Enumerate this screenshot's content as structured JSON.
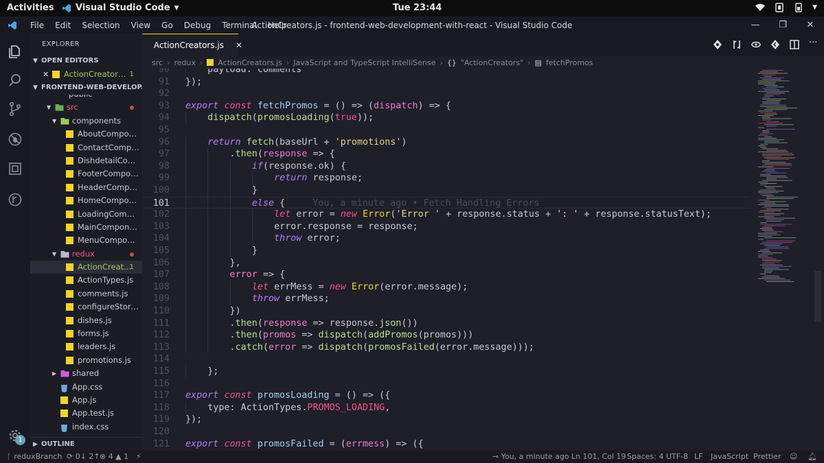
{
  "topbar": {
    "activities": "Activities",
    "app_name": "Visual Studio Code",
    "clock": "Tue 23:44"
  },
  "menubar": {
    "items": [
      "File",
      "Edit",
      "Selection",
      "View",
      "Go",
      "Debug",
      "Terminal",
      "Help"
    ],
    "window_title": "ActionCreators.js - frontend-web-development-with-react - Visual Studio Code"
  },
  "activity": {
    "badge": "1"
  },
  "sidebar": {
    "title": "EXPLORER",
    "open_editors": "OPEN EDITORS",
    "open_file": {
      "name": "ActionCreators...",
      "count": "1"
    },
    "project": "FRONTEND-WEB-DEVELOP...",
    "partial_top": "public",
    "rows": [
      {
        "name": "src",
        "type": "folder-open",
        "indent": 1,
        "color": "#f55385",
        "dot": true
      },
      {
        "name": "components",
        "type": "folder-open",
        "indent": 2
      },
      {
        "name": "AboutCompone...",
        "type": "js",
        "indent": 3
      },
      {
        "name": "ContactCompon...",
        "type": "js",
        "indent": 3
      },
      {
        "name": "DishdetailComp...",
        "type": "js",
        "indent": 3
      },
      {
        "name": "FooterCompone...",
        "type": "js",
        "indent": 3
      },
      {
        "name": "HeaderCompon...",
        "type": "js",
        "indent": 3
      },
      {
        "name": "HomeCompone...",
        "type": "js",
        "indent": 3
      },
      {
        "name": "LoadingCompon...",
        "type": "js",
        "indent": 3
      },
      {
        "name": "MainComponent.js",
        "type": "js",
        "indent": 3
      },
      {
        "name": "MenuComponen...",
        "type": "js",
        "indent": 3
      },
      {
        "name": "redux",
        "type": "folder-open",
        "indent": 2,
        "color": "#f55385",
        "dot": true
      },
      {
        "name": "ActionCreat...",
        "type": "js",
        "indent": 3,
        "color": "#9fca56",
        "count": "1",
        "selected": true
      },
      {
        "name": "ActionTypes.js",
        "type": "js",
        "indent": 3
      },
      {
        "name": "comments.js",
        "type": "js",
        "indent": 3
      },
      {
        "name": "configureStore.js",
        "type": "js",
        "indent": 3
      },
      {
        "name": "dishes.js",
        "type": "js",
        "indent": 3
      },
      {
        "name": "forms.js",
        "type": "js",
        "indent": 3
      },
      {
        "name": "leaders.js",
        "type": "js",
        "indent": 3
      },
      {
        "name": "promotions.js",
        "type": "js",
        "indent": 3
      },
      {
        "name": "shared",
        "type": "folder-closed",
        "indent": 2
      },
      {
        "name": "App.css",
        "type": "css",
        "indent": 2
      },
      {
        "name": "App.js",
        "type": "js",
        "indent": 2
      },
      {
        "name": "App.test.js",
        "type": "js",
        "indent": 2
      },
      {
        "name": "index.css",
        "type": "css",
        "indent": 2
      }
    ],
    "outline": "OUTLINE"
  },
  "editor": {
    "tab_label": "ActionCreators.js",
    "tab_close": "✕",
    "breadcrumb": [
      "src",
      "redux",
      "ActionCreators.js",
      "JavaScript and TypeScript IntelliSense",
      "\"ActionCreators\"",
      "fetchPromos"
    ],
    "current_line": 101,
    "blame": "You, a minute ago • Fetch Handling Errors",
    "lines": [
      {
        "n": 90,
        "indent": 1,
        "tokens": [
          [
            "plain",
            "payload: comments"
          ]
        ]
      },
      {
        "n": 91,
        "indent": 0,
        "tokens": [
          [
            "pun",
            "});"
          ]
        ]
      },
      {
        "n": 92,
        "indent": 0,
        "tokens": []
      },
      {
        "n": 93,
        "indent": 0,
        "tokens": [
          [
            "kw2",
            "export"
          ],
          [
            "plain",
            " "
          ],
          [
            "kw",
            "const"
          ],
          [
            "plain",
            " "
          ],
          [
            "fn",
            "fetchPromos"
          ],
          [
            "plain",
            " = () => ("
          ],
          [
            "par",
            "dispatch"
          ],
          [
            "plain",
            ") => {"
          ]
        ]
      },
      {
        "n": 94,
        "indent": 1,
        "tokens": [
          [
            "fnc",
            "dispatch"
          ],
          [
            "plain",
            "("
          ],
          [
            "fnc",
            "promosLoading"
          ],
          [
            "plain",
            "("
          ],
          [
            "const",
            "true"
          ],
          [
            "plain",
            "));"
          ]
        ]
      },
      {
        "n": 95,
        "indent": 0,
        "tokens": []
      },
      {
        "n": 96,
        "indent": 1,
        "tokens": [
          [
            "kw2",
            "return"
          ],
          [
            "plain",
            " "
          ],
          [
            "fnc",
            "fetch"
          ],
          [
            "plain",
            "(baseUrl + "
          ],
          [
            "str",
            "'promotions'"
          ],
          [
            "plain",
            ")"
          ]
        ]
      },
      {
        "n": 97,
        "indent": 2,
        "tokens": [
          [
            "plain",
            "."
          ],
          [
            "fnc",
            "then"
          ],
          [
            "plain",
            "("
          ],
          [
            "par",
            "response"
          ],
          [
            "plain",
            " => {"
          ]
        ]
      },
      {
        "n": 98,
        "indent": 3,
        "tokens": [
          [
            "kw2",
            "if"
          ],
          [
            "plain",
            "(response.ok) {"
          ]
        ]
      },
      {
        "n": 99,
        "indent": 4,
        "tokens": [
          [
            "kw2",
            "return"
          ],
          [
            "plain",
            " response;"
          ]
        ]
      },
      {
        "n": 100,
        "indent": 3,
        "tokens": [
          [
            "plain",
            "}"
          ]
        ]
      },
      {
        "n": 101,
        "indent": 3,
        "tokens": [
          [
            "kw2",
            "else"
          ],
          [
            "plain",
            " {"
          ]
        ],
        "blame": true
      },
      {
        "n": 102,
        "indent": 4,
        "tokens": [
          [
            "kw",
            "let"
          ],
          [
            "plain",
            " error = "
          ],
          [
            "kw",
            "new"
          ],
          [
            "plain",
            " "
          ],
          [
            "cls",
            "Error"
          ],
          [
            "plain",
            "("
          ],
          [
            "str",
            "'Error '"
          ],
          [
            "plain",
            " + response.status + "
          ],
          [
            "str",
            "': '"
          ],
          [
            "plain",
            " + response.statusText);"
          ]
        ]
      },
      {
        "n": 103,
        "indent": 4,
        "tokens": [
          [
            "plain",
            "error.response = response;"
          ]
        ]
      },
      {
        "n": 104,
        "indent": 4,
        "tokens": [
          [
            "kw2",
            "throw"
          ],
          [
            "plain",
            " error;"
          ]
        ]
      },
      {
        "n": 105,
        "indent": 3,
        "tokens": [
          [
            "plain",
            "}"
          ]
        ]
      },
      {
        "n": 106,
        "indent": 2,
        "tokens": [
          [
            "plain",
            "},"
          ]
        ]
      },
      {
        "n": 107,
        "indent": 2,
        "tokens": [
          [
            "par",
            "error"
          ],
          [
            "plain",
            " => {"
          ]
        ]
      },
      {
        "n": 108,
        "indent": 3,
        "tokens": [
          [
            "kw",
            "let"
          ],
          [
            "plain",
            " errMess = "
          ],
          [
            "kw",
            "new"
          ],
          [
            "plain",
            " "
          ],
          [
            "cls",
            "Error"
          ],
          [
            "plain",
            "(error.message);"
          ]
        ]
      },
      {
        "n": 109,
        "indent": 3,
        "tokens": [
          [
            "kw2",
            "throw"
          ],
          [
            "plain",
            " errMess;"
          ]
        ]
      },
      {
        "n": 110,
        "indent": 2,
        "tokens": [
          [
            "plain",
            "})"
          ]
        ]
      },
      {
        "n": 111,
        "indent": 2,
        "tokens": [
          [
            "plain",
            "."
          ],
          [
            "fnc",
            "then"
          ],
          [
            "plain",
            "("
          ],
          [
            "par",
            "response"
          ],
          [
            "plain",
            " => response."
          ],
          [
            "fnc",
            "json"
          ],
          [
            "plain",
            "())"
          ]
        ]
      },
      {
        "n": 112,
        "indent": 2,
        "tokens": [
          [
            "plain",
            "."
          ],
          [
            "fnc",
            "then"
          ],
          [
            "plain",
            "("
          ],
          [
            "par",
            "promos"
          ],
          [
            "plain",
            " => "
          ],
          [
            "fnc",
            "dispatch"
          ],
          [
            "plain",
            "("
          ],
          [
            "fnc",
            "addPromos"
          ],
          [
            "plain",
            "(promos)))"
          ]
        ]
      },
      {
        "n": 113,
        "indent": 2,
        "tokens": [
          [
            "plain",
            "."
          ],
          [
            "fnc",
            "catch"
          ],
          [
            "plain",
            "("
          ],
          [
            "par",
            "error"
          ],
          [
            "plain",
            " => "
          ],
          [
            "fnc",
            "dispatch"
          ],
          [
            "plain",
            "("
          ],
          [
            "fnc",
            "promosFailed"
          ],
          [
            "plain",
            "(error.message)));"
          ]
        ]
      },
      {
        "n": 114,
        "indent": 0,
        "tokens": []
      },
      {
        "n": 115,
        "indent": 1,
        "tokens": [
          [
            "plain",
            "};"
          ]
        ]
      },
      {
        "n": 116,
        "indent": 0,
        "tokens": []
      },
      {
        "n": 117,
        "indent": 0,
        "tokens": [
          [
            "kw2",
            "export"
          ],
          [
            "plain",
            " "
          ],
          [
            "kw",
            "const"
          ],
          [
            "plain",
            " "
          ],
          [
            "fn",
            "promosLoading"
          ],
          [
            "plain",
            " = () => ({"
          ]
        ]
      },
      {
        "n": 118,
        "indent": 1,
        "tokens": [
          [
            "plain",
            "type: ActionTypes."
          ],
          [
            "const",
            "PROMOS_LOADING"
          ],
          [
            "plain",
            ","
          ]
        ]
      },
      {
        "n": 119,
        "indent": 0,
        "tokens": [
          [
            "plain",
            "});"
          ]
        ]
      },
      {
        "n": 120,
        "indent": 0,
        "tokens": []
      },
      {
        "n": 121,
        "indent": 0,
        "tokens": [
          [
            "kw2",
            "export"
          ],
          [
            "plain",
            " "
          ],
          [
            "kw",
            "const"
          ],
          [
            "plain",
            " "
          ],
          [
            "fn",
            "promosFailed"
          ],
          [
            "plain",
            " = ("
          ],
          [
            "par",
            "errmess"
          ],
          [
            "plain",
            ") => ({"
          ]
        ]
      }
    ]
  },
  "statusbar": {
    "branch": "reduxBranch",
    "sync": "0↓ 2↑",
    "errors": "4",
    "warnings": "1",
    "blame": "You, a minute ago",
    "position": "Ln 101, Col 19",
    "spaces": "Spaces: 4",
    "encoding": "UTF-8",
    "eol": "LF",
    "language": "JavaScript",
    "formatter": "Prettier"
  },
  "colors": {
    "accent": "#f2d42a",
    "keyword": "#f55385",
    "string": "#e8d58c",
    "function": "#b9df90"
  }
}
